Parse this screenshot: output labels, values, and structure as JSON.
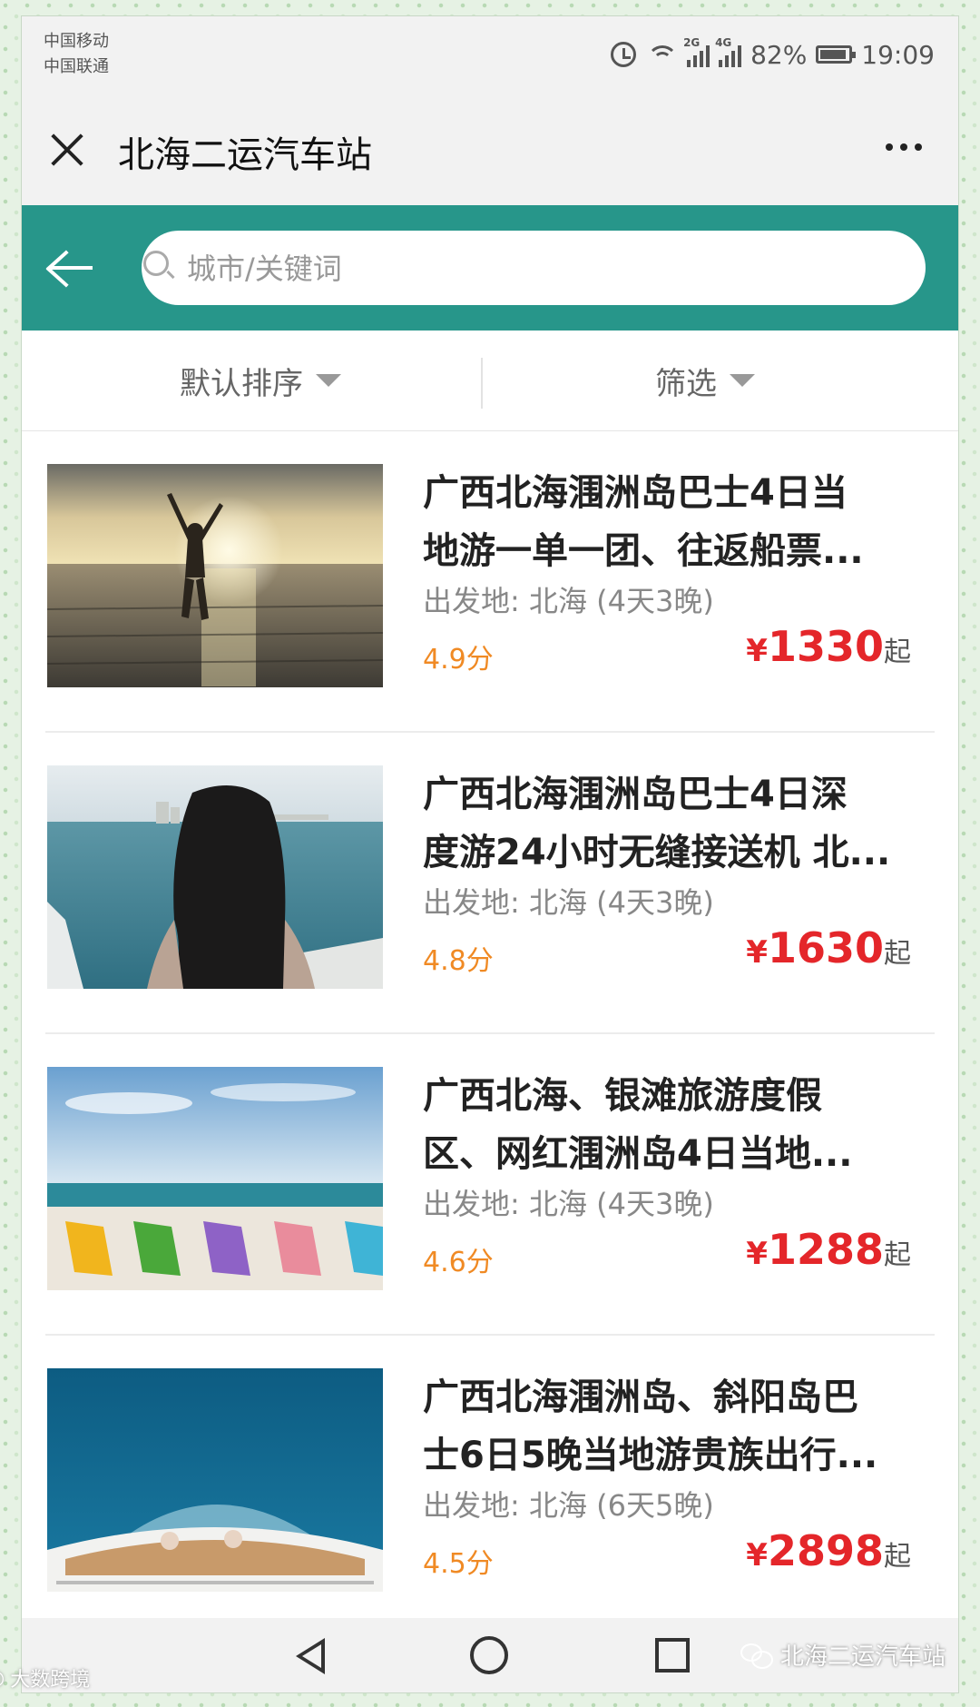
{
  "status_bar": {
    "carrier_1": "中国移动",
    "carrier_2": "中国联通",
    "net_1": "2G",
    "net_2": "4G",
    "battery": "82%",
    "time": "19:09"
  },
  "title_bar": {
    "title": "北海二运汽车站",
    "more_icon": "more-icon"
  },
  "search": {
    "placeholder": "城市/关键词",
    "bar_color": "#27968a"
  },
  "sort_bar": {
    "default_sort": "默认排序",
    "filter": "筛选"
  },
  "products": [
    {
      "title_line_1": "广西北海涠洲岛巴士4日当",
      "title_line_2": "地游一单一团、往返船票...",
      "origin": "出发地: 北海 (4天3晚)",
      "rating": "4.9分",
      "currency": "¥",
      "price": "1330",
      "price_suffix": "起"
    },
    {
      "title_line_1": "广西北海涠洲岛巴士4日深",
      "title_line_2": "度游24小时无缝接送机 北...",
      "origin": "出发地: 北海 (4天3晚)",
      "rating": "4.8分",
      "currency": "¥",
      "price": "1630",
      "price_suffix": "起"
    },
    {
      "title_line_1": "广西北海、银滩旅游度假",
      "title_line_2": "区、网红涠洲岛4日当地...",
      "origin": "出发地: 北海 (4天3晚)",
      "rating": "4.6分",
      "currency": "¥",
      "price": "1288",
      "price_suffix": "起"
    },
    {
      "title_line_1": "广西北海涠洲岛、斜阳岛巴",
      "title_line_2": "士6日5晚当地游贵族出行...",
      "origin": "出发地: 北海 (6天5晚)",
      "rating": "4.5分",
      "currency": "¥",
      "price": "2898",
      "price_suffix": "起"
    }
  ],
  "watermark": {
    "right_text": "北海二运汽车站",
    "left_text": "大数跨境"
  },
  "colors": {
    "accent": "#27968a",
    "price": "#e4262a",
    "rating": "#f08a24"
  }
}
